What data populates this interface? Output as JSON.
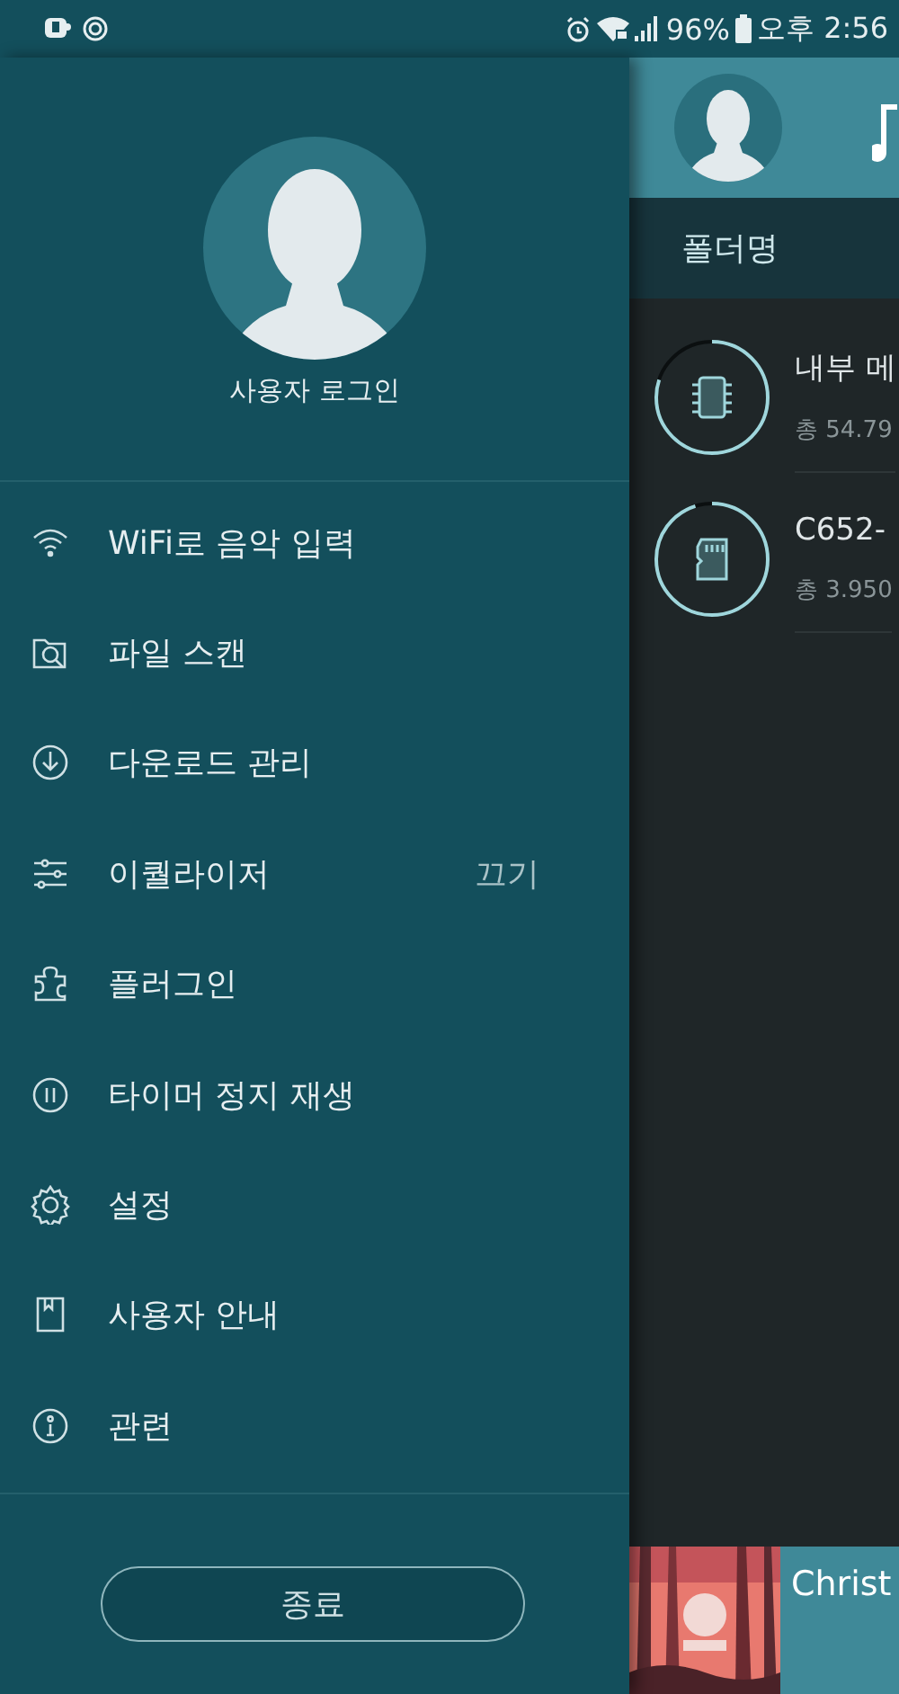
{
  "status_bar": {
    "battery": "96%",
    "time": "오후 2:56"
  },
  "drawer": {
    "login": "사용자 로그인",
    "menu": [
      {
        "label": "WiFi로 음악 입력"
      },
      {
        "label": "파일 스캔"
      },
      {
        "label": "다운로드 관리"
      },
      {
        "label": "이퀄라이저",
        "value": "끄기"
      },
      {
        "label": "플러그인"
      },
      {
        "label": "타이머 정지 재생"
      },
      {
        "label": "설정"
      },
      {
        "label": "사용자 안내"
      },
      {
        "label": "관련"
      }
    ],
    "exit_button": "종료"
  },
  "main": {
    "tab": "폴더명",
    "storages": [
      {
        "kind": "internal",
        "name": "내부 메",
        "total": "총 54.79"
      },
      {
        "kind": "sdcard",
        "name": "C652-",
        "total": "총 3.950"
      }
    ],
    "player": {
      "title": "Christ"
    }
  }
}
